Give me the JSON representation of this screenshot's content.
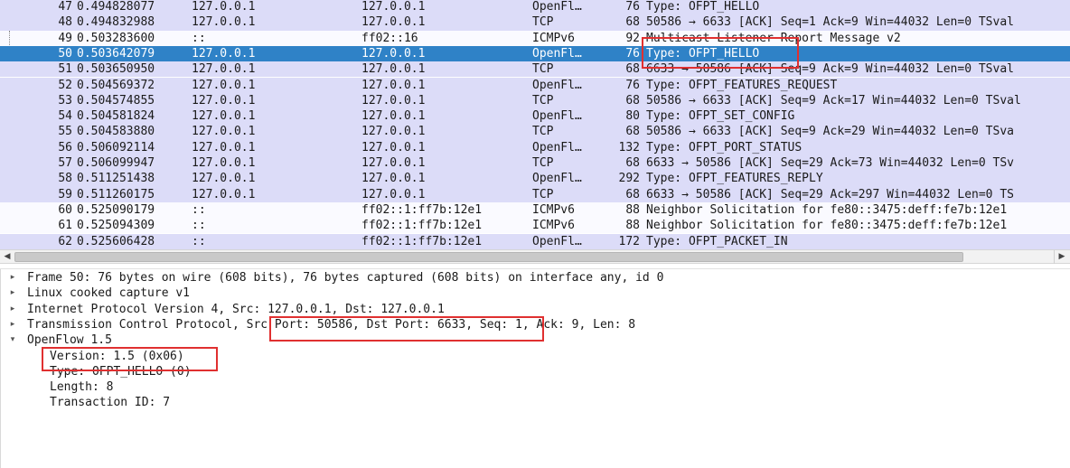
{
  "packet_list": {
    "selected_index": 3,
    "colors": {
      "row_bg": "#dcdcf8",
      "row_bg_light": "#fafaff",
      "selected_bg": "#2f82c7",
      "selected_text": "#ffffff",
      "text": "#1a1a1a"
    },
    "rows": [
      {
        "no": "47",
        "time": "0.494828077",
        "source": "127.0.0.1",
        "destination": "127.0.0.1",
        "protocol": "OpenFl…",
        "length": "76",
        "info": "Type: OFPT_HELLO",
        "bg": "#dcdcf8"
      },
      {
        "no": "48",
        "time": "0.494832988",
        "source": "127.0.0.1",
        "destination": "127.0.0.1",
        "protocol": "TCP",
        "length": "68",
        "info": "50586 → 6633 [ACK] Seq=1 Ack=9 Win=44032 Len=0 TSval",
        "bg": "#dcdcf8"
      },
      {
        "no": "49",
        "time": "0.503283600",
        "source": "::",
        "destination": "ff02::16",
        "protocol": "ICMPv6",
        "length": "92",
        "info": "Multicast Listener Report Message v2",
        "bg": "#fafaff"
      },
      {
        "no": "50",
        "time": "0.503642079",
        "source": "127.0.0.1",
        "destination": "127.0.0.1",
        "protocol": "OpenFl…",
        "length": "76",
        "info": "Type: OFPT_HELLO",
        "bg": "#2f82c7"
      },
      {
        "no": "51",
        "time": "0.503650950",
        "source": "127.0.0.1",
        "destination": "127.0.0.1",
        "protocol": "TCP",
        "length": "68",
        "info": "6633 → 50586 [ACK] Seq=9 Ack=9 Win=44032 Len=0 TSval",
        "bg": "#dcdcf8"
      },
      {
        "no": "52",
        "time": "0.504569372",
        "source": "127.0.0.1",
        "destination": "127.0.0.1",
        "protocol": "OpenFl…",
        "length": "76",
        "info": "Type: OFPT_FEATURES_REQUEST",
        "bg": "#dcdcf8"
      },
      {
        "no": "53",
        "time": "0.504574855",
        "source": "127.0.0.1",
        "destination": "127.0.0.1",
        "protocol": "TCP",
        "length": "68",
        "info": "50586 → 6633 [ACK] Seq=9 Ack=17 Win=44032 Len=0 TSval",
        "bg": "#dcdcf8"
      },
      {
        "no": "54",
        "time": "0.504581824",
        "source": "127.0.0.1",
        "destination": "127.0.0.1",
        "protocol": "OpenFl…",
        "length": "80",
        "info": "Type: OFPT_SET_CONFIG",
        "bg": "#dcdcf8"
      },
      {
        "no": "55",
        "time": "0.504583880",
        "source": "127.0.0.1",
        "destination": "127.0.0.1",
        "protocol": "TCP",
        "length": "68",
        "info": "50586 → 6633 [ACK] Seq=9 Ack=29 Win=44032 Len=0 TSva",
        "bg": "#dcdcf8"
      },
      {
        "no": "56",
        "time": "0.506092114",
        "source": "127.0.0.1",
        "destination": "127.0.0.1",
        "protocol": "OpenFl…",
        "length": "132",
        "info": "Type: OFPT_PORT_STATUS",
        "bg": "#dcdcf8"
      },
      {
        "no": "57",
        "time": "0.506099947",
        "source": "127.0.0.1",
        "destination": "127.0.0.1",
        "protocol": "TCP",
        "length": "68",
        "info": "6633 → 50586 [ACK] Seq=29 Ack=73 Win=44032 Len=0 TSv",
        "bg": "#dcdcf8"
      },
      {
        "no": "58",
        "time": "0.511251438",
        "source": "127.0.0.1",
        "destination": "127.0.0.1",
        "protocol": "OpenFl…",
        "length": "292",
        "info": "Type: OFPT_FEATURES_REPLY",
        "bg": "#dcdcf8"
      },
      {
        "no": "59",
        "time": "0.511260175",
        "source": "127.0.0.1",
        "destination": "127.0.0.1",
        "protocol": "TCP",
        "length": "68",
        "info": "6633 → 50586 [ACK] Seq=29 Ack=297 Win=44032 Len=0 TS",
        "bg": "#dcdcf8"
      },
      {
        "no": "60",
        "time": "0.525090179",
        "source": "::",
        "destination": "ff02::1:ff7b:12e1",
        "protocol": "ICMPv6",
        "length": "88",
        "info": "Neighbor Solicitation for fe80::3475:deff:fe7b:12e1",
        "bg": "#fafaff"
      },
      {
        "no": "61",
        "time": "0.525094309",
        "source": "::",
        "destination": "ff02::1:ff7b:12e1",
        "protocol": "ICMPv6",
        "length": "88",
        "info": "Neighbor Solicitation for fe80::3475:deff:fe7b:12e1",
        "bg": "#fafaff"
      },
      {
        "no": "62",
        "time": "0.525606428",
        "source": "::",
        "destination": "ff02::1:ff7b:12e1",
        "protocol": "OpenFl…",
        "length": "172",
        "info": "Type: OFPT_PACKET_IN",
        "bg": "#dcdcf8"
      }
    ]
  },
  "scrollbar": {
    "left_icon": "arrow-left-icon",
    "right_icon": "arrow-right-icon",
    "left_glyph": "◀",
    "right_glyph": "▶"
  },
  "details": {
    "collapsed_glyph": "▸",
    "expanded_glyph": "▾",
    "rows": [
      {
        "text": "Frame 50: 76 bytes on wire (608 bits), 76 bytes captured (608 bits) on interface any, id 0",
        "indent": 0,
        "toggle": "collapsed"
      },
      {
        "text": "Linux cooked capture v1",
        "indent": 0,
        "toggle": "collapsed"
      },
      {
        "text": "Internet Protocol Version 4, Src: 127.0.0.1, Dst: 127.0.0.1",
        "indent": 0,
        "toggle": "collapsed"
      },
      {
        "text": "Transmission Control Protocol, Src Port: 50586, Dst Port: 6633, Seq: 1, Ack: 9, Len: 8",
        "indent": 0,
        "toggle": "collapsed"
      },
      {
        "text": "OpenFlow 1.5",
        "indent": 0,
        "toggle": "expanded"
      },
      {
        "text": "Version: 1.5 (0x06)",
        "indent": 1,
        "toggle": "none"
      },
      {
        "text": "Type: OFPT_HELLO (0)",
        "indent": 1,
        "toggle": "none"
      },
      {
        "text": "Length: 8",
        "indent": 1,
        "toggle": "none"
      },
      {
        "text": "Transaction ID: 7",
        "indent": 1,
        "toggle": "none"
      }
    ]
  },
  "highlights": {
    "color": "#e03030"
  }
}
